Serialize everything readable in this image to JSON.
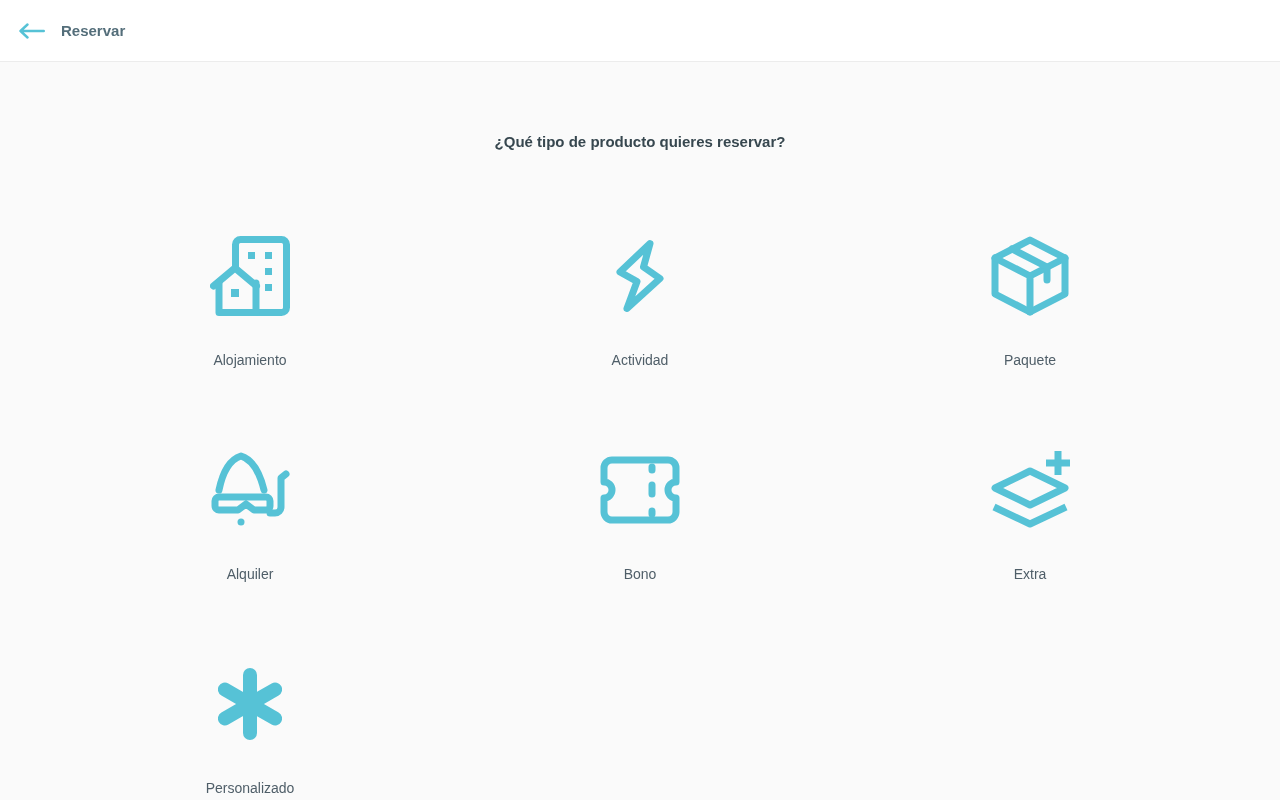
{
  "header": {
    "title": "Reservar"
  },
  "prompt": "¿Qué tipo de producto quieres reservar?",
  "options": [
    {
      "kind": "building",
      "label": "Alojamiento"
    },
    {
      "kind": "bolt",
      "label": "Actividad"
    },
    {
      "kind": "box",
      "label": "Paquete"
    },
    {
      "kind": "snorkel",
      "label": "Alquiler"
    },
    {
      "kind": "ticket",
      "label": "Bono"
    },
    {
      "kind": "layers",
      "label": "Extra"
    },
    {
      "kind": "asterisk",
      "label": "Personalizado"
    }
  ]
}
